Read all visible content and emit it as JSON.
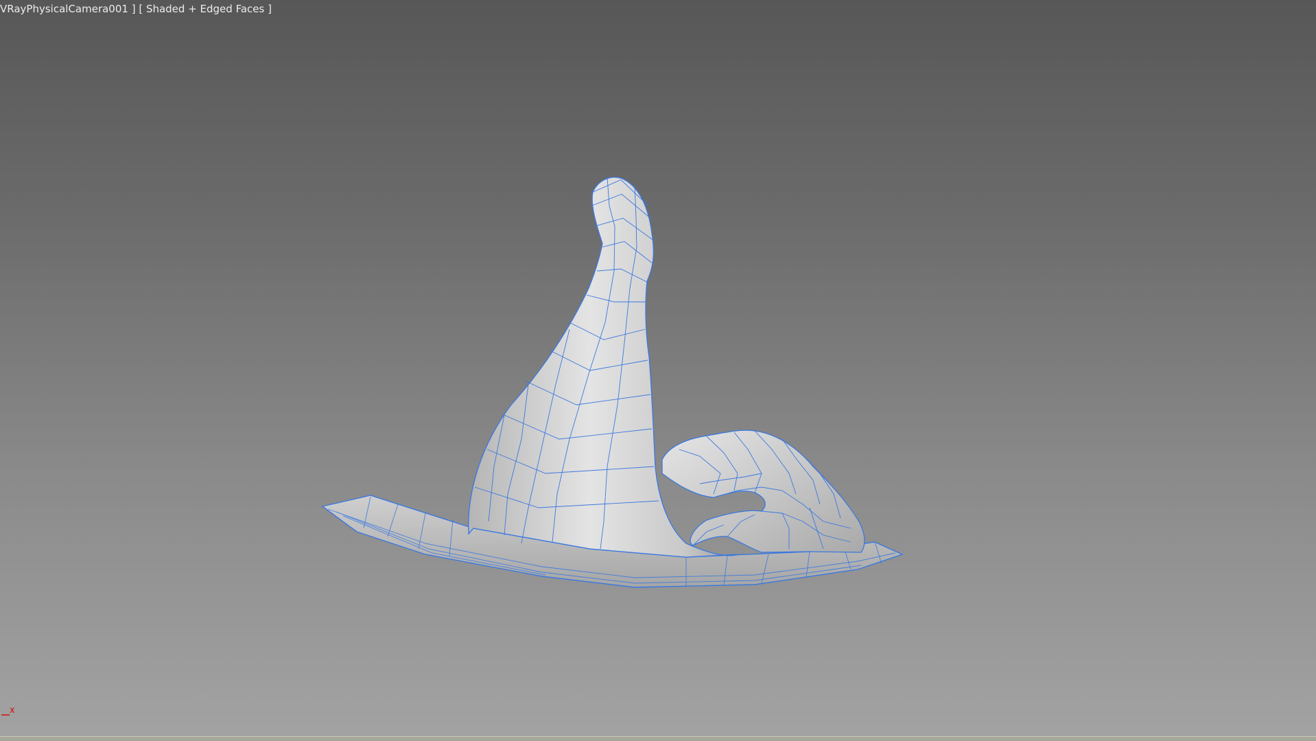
{
  "viewport": {
    "label": "VRayPhysicalCamera001 ] [ Shaded + Edged Faces ]",
    "mode": "Shaded + Edged Faces",
    "background_top_color": "#575757",
    "background_bottom_color": "#a3a3a3"
  },
  "model": {
    "surface_color": "#c9c9c9",
    "edge_color": "#3a78e0"
  },
  "axis_gizmo": {
    "x_label": "x",
    "x_color": "#d01010"
  }
}
